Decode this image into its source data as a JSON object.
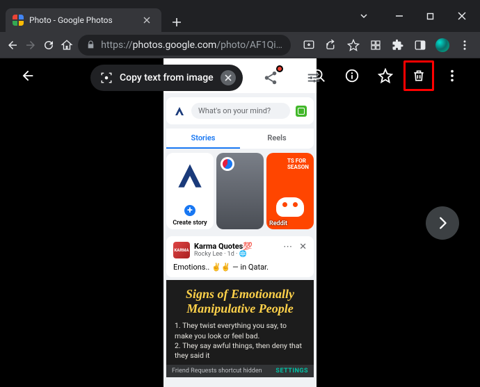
{
  "browser": {
    "tab_title": "Photo - Google Photos",
    "url_https": "https://",
    "url_domain": "photos.google.com",
    "url_path": "/photo/AF1Qi…"
  },
  "viewer": {
    "pill_label": "Copy text from image"
  },
  "feed": {
    "composer_placeholder": "What's on your mind?",
    "tab_stories": "Stories",
    "tab_reels": "Reels",
    "create_story": "Create story",
    "story3_tag": "TS FOR SEASON",
    "story3_name": "Reddit",
    "post": {
      "author": "Karma Quotes💯",
      "subline": "Rocky Lee · 1d · 🌐",
      "body": "Emotions.. ✌️✌️ — in Qatar."
    },
    "meme": {
      "title_line1": "Signs of Emotionally",
      "title_line2": "Manipulative People",
      "item1": "1. They twist everything you say, to make you look or feel bad.",
      "item2": "2. They say awful things, then deny that they said it"
    },
    "footer_text": "Friend Requests shortcut hidden",
    "footer_action": "SETTINGS"
  }
}
